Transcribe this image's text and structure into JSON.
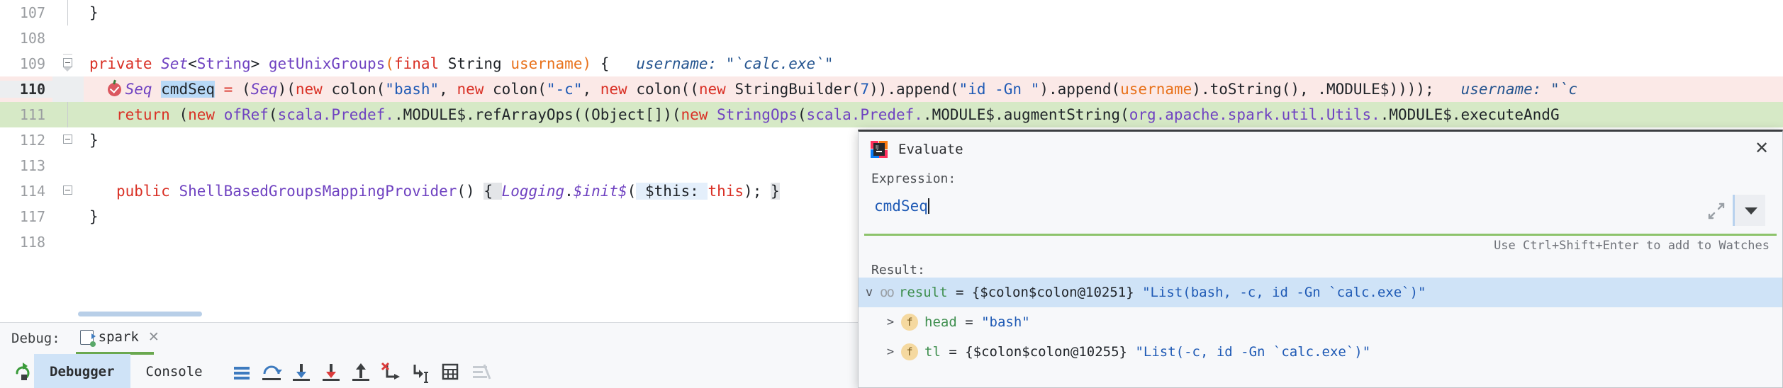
{
  "editor": {
    "lines": [
      {
        "num": "107",
        "state": "normal"
      },
      {
        "num": "108",
        "state": "normal"
      },
      {
        "num": "109",
        "state": "normal"
      },
      {
        "num": "110",
        "state": "current"
      },
      {
        "num": "111",
        "state": "executed"
      },
      {
        "num": "112",
        "state": "normal"
      },
      {
        "num": "113",
        "state": "normal"
      },
      {
        "num": "114",
        "state": "normal"
      },
      {
        "num": "117",
        "state": "normal"
      },
      {
        "num": "118",
        "state": "normal"
      }
    ],
    "code": {
      "line107": "}",
      "line109_signature": "private Set<String> getUnixGroups(final String username) {",
      "line109_hint": "username: \"`calc.exe`\"",
      "line110_full": "Seq cmdSeq = (Seq)(new colon(\"bash\", new colon(\"-c\", new colon((new StringBuilder(7)).append(\"id -Gn \").append(username).toString(), .MODULE$))));",
      "line110_hint": "username: \"`c",
      "line110_selected_token": "cmdSeq",
      "line111_full": "return (new ofRef(scala.Predef..MODULE$.refArrayOps((Object[])(new StringOps(scala.Predef..MODULE$.augmentString(org.apache.spark.util.Utils..MODULE$.executeAndG",
      "line112": "}",
      "line114_full": "public ShellBasedGroupsMappingProvider() { Logging.$init$( $this: this); }",
      "line117": "}"
    }
  },
  "evaluate_dialog": {
    "title": "Evaluate",
    "app_icon": "intellij-idea-icon",
    "close_icon": "close-icon",
    "expression_label": "Expression:",
    "expression_value": "cmdSeq",
    "expression_placeholder": "",
    "expand_icon": "expand-diagonal-icon",
    "dropdown_icon": "chevron-down-icon",
    "watches_hint": "Use Ctrl+Shift+Enter to add to Watches",
    "result_label": "Result:",
    "result_rows": [
      {
        "chevron": "v",
        "icon": "oo",
        "name": "result",
        "eq": " = ",
        "ref": "{$colon$colon@10251}",
        "value": "\"List(bash, -c, id -Gn `calc.exe`)\"",
        "selected": true,
        "indent": 0
      },
      {
        "chevron": ">",
        "icon": "f",
        "name": "head",
        "eq": " = ",
        "ref": "",
        "value": "\"bash\"",
        "selected": false,
        "indent": 1
      },
      {
        "chevron": ">",
        "icon": "f",
        "name": "tl",
        "eq": " = ",
        "ref": "{$colon$colon@10255}",
        "value": "\"List(-c, id -Gn `calc.exe`)\"",
        "selected": false,
        "indent": 1
      }
    ]
  },
  "debug_panel": {
    "label": "Debug:",
    "session_tab": "spark",
    "session_close_icon": "close-icon",
    "restart_icon": "rerun-icon",
    "tabs": [
      {
        "label": "Debugger",
        "active": true
      },
      {
        "label": "Console",
        "active": false
      }
    ],
    "toolbar_icons": [
      "show-execution-point-icon",
      "step-over-icon",
      "step-into-icon",
      "force-step-into-icon",
      "step-out-icon",
      "drop-frame-icon",
      "run-to-cursor-icon",
      "evaluate-expression-icon",
      "mute-breakpoints-icon"
    ]
  },
  "colors": {
    "current_line_bg": "#fbe9e7",
    "executed_line_bg": "#d6e9c6",
    "selection_bg": "#b8d9f7",
    "accent_green": "#6aa84f",
    "keyword_red": "#d93025",
    "type_purple": "#6f42c1",
    "string_blue": "#1f5ab5",
    "param_orange": "#e8711a",
    "hint_blue": "#24548f"
  }
}
